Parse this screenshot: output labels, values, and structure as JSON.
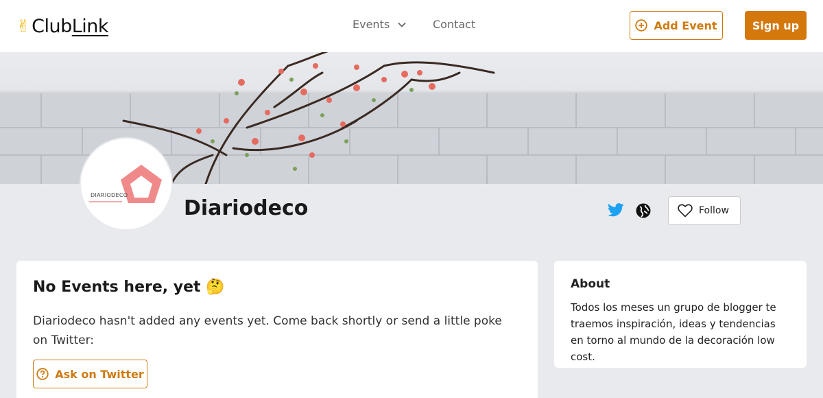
{
  "header": {
    "logo_mark": "✌",
    "logo_part1": "Club",
    "logo_part2": "Link",
    "nav_events": "Events",
    "nav_contact": "Contact",
    "add_event_label": "Add Event",
    "signup_label": "Sign up"
  },
  "profile": {
    "name": "Diariodeco",
    "avatar_text": "DIARIODECO",
    "follow_label": "Follow"
  },
  "events": {
    "title": "No Events here, yet 🤔",
    "message": "Diariodeco hasn't added any events yet. Come back shortly or send a little poke on Twitter:",
    "ask_label": "Ask on Twitter"
  },
  "about": {
    "title": "About",
    "text": "Todos los meses un grupo de blogger te traemos inspiración, ideas y tendencias en torno al mundo de la decoración low cost."
  },
  "colors": {
    "accent": "#d4780c",
    "twitter": "#1da1f2",
    "page_bg": "#e8eaee"
  }
}
